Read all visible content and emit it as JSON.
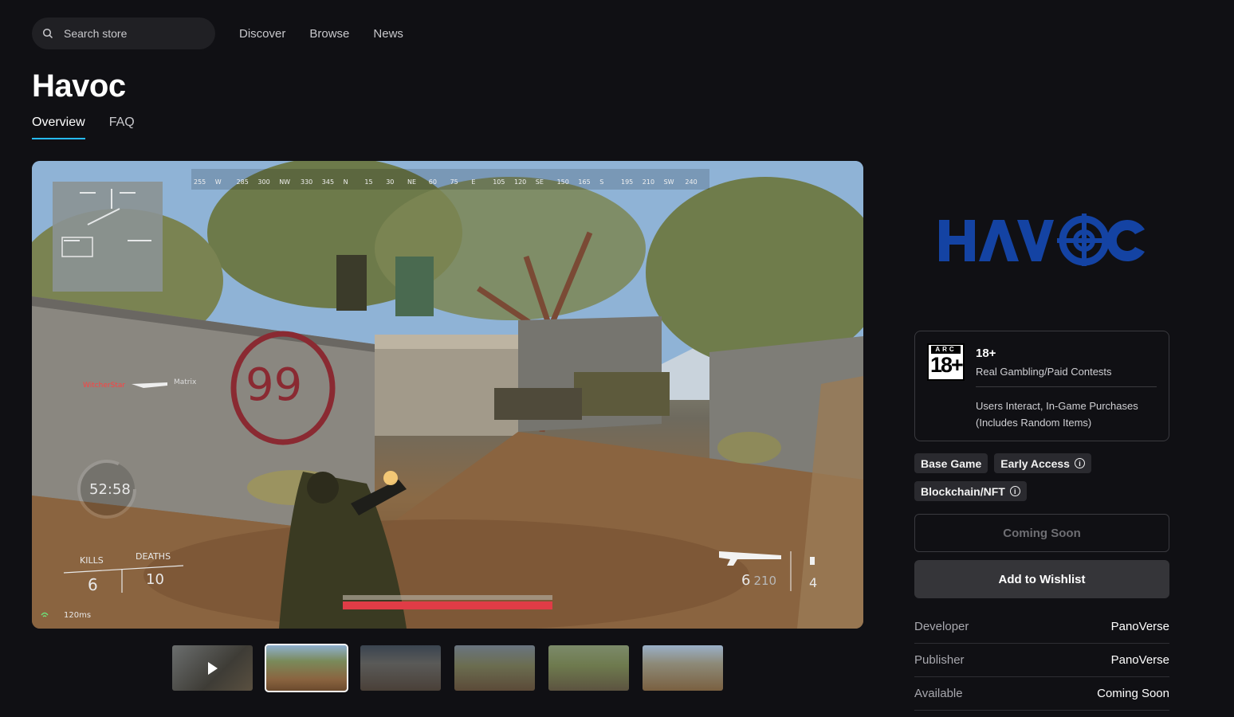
{
  "search": {
    "placeholder": "Search store"
  },
  "nav": {
    "items": [
      "Discover",
      "Browse",
      "News"
    ]
  },
  "game": {
    "title": "Havoc"
  },
  "tabs": [
    "Overview",
    "FAQ"
  ],
  "hud": {
    "compass": [
      "255",
      "W",
      "285",
      "300",
      "NW",
      "330",
      "345",
      "N",
      "15",
      "30",
      "NE",
      "60",
      "75",
      "E",
      "105",
      "120",
      "SE",
      "150",
      "165",
      "S",
      "195",
      "210",
      "SW",
      "240"
    ],
    "killfeed_killer": "WitcherStar",
    "killfeed_victim": "Matrix",
    "timer": "52:58",
    "kills_label": "KILLS",
    "deaths_label": "DEATHS",
    "kills": "6",
    "deaths": "10",
    "ping": "120ms",
    "ammo": "6",
    "ammo_reserve": "210",
    "grenades": "4"
  },
  "thumbnails": {
    "count": 6,
    "selected_index": 1,
    "video_index": 0
  },
  "logo": {
    "text": "HAVOC",
    "color": "#1443a3"
  },
  "rating": {
    "badge_org": "ARC",
    "badge_age": "18+",
    "age": "18+",
    "descriptor": "Real Gambling/Paid Contests",
    "interactive": "Users Interact, In-Game Purchases (Includes Random Items)"
  },
  "tags": [
    {
      "label": "Base Game",
      "info": false
    },
    {
      "label": "Early Access",
      "info": true
    },
    {
      "label": "Blockchain/NFT",
      "info": true
    }
  ],
  "buttons": {
    "primary": "Coming Soon",
    "wishlist": "Add to Wishlist"
  },
  "meta": [
    {
      "key": "Developer",
      "value": "PanoVerse"
    },
    {
      "key": "Publisher",
      "value": "PanoVerse"
    },
    {
      "key": "Available",
      "value": "Coming Soon"
    }
  ],
  "colors": {
    "background": "#101014",
    "accent": "#26bbff",
    "panel": "#202024"
  }
}
